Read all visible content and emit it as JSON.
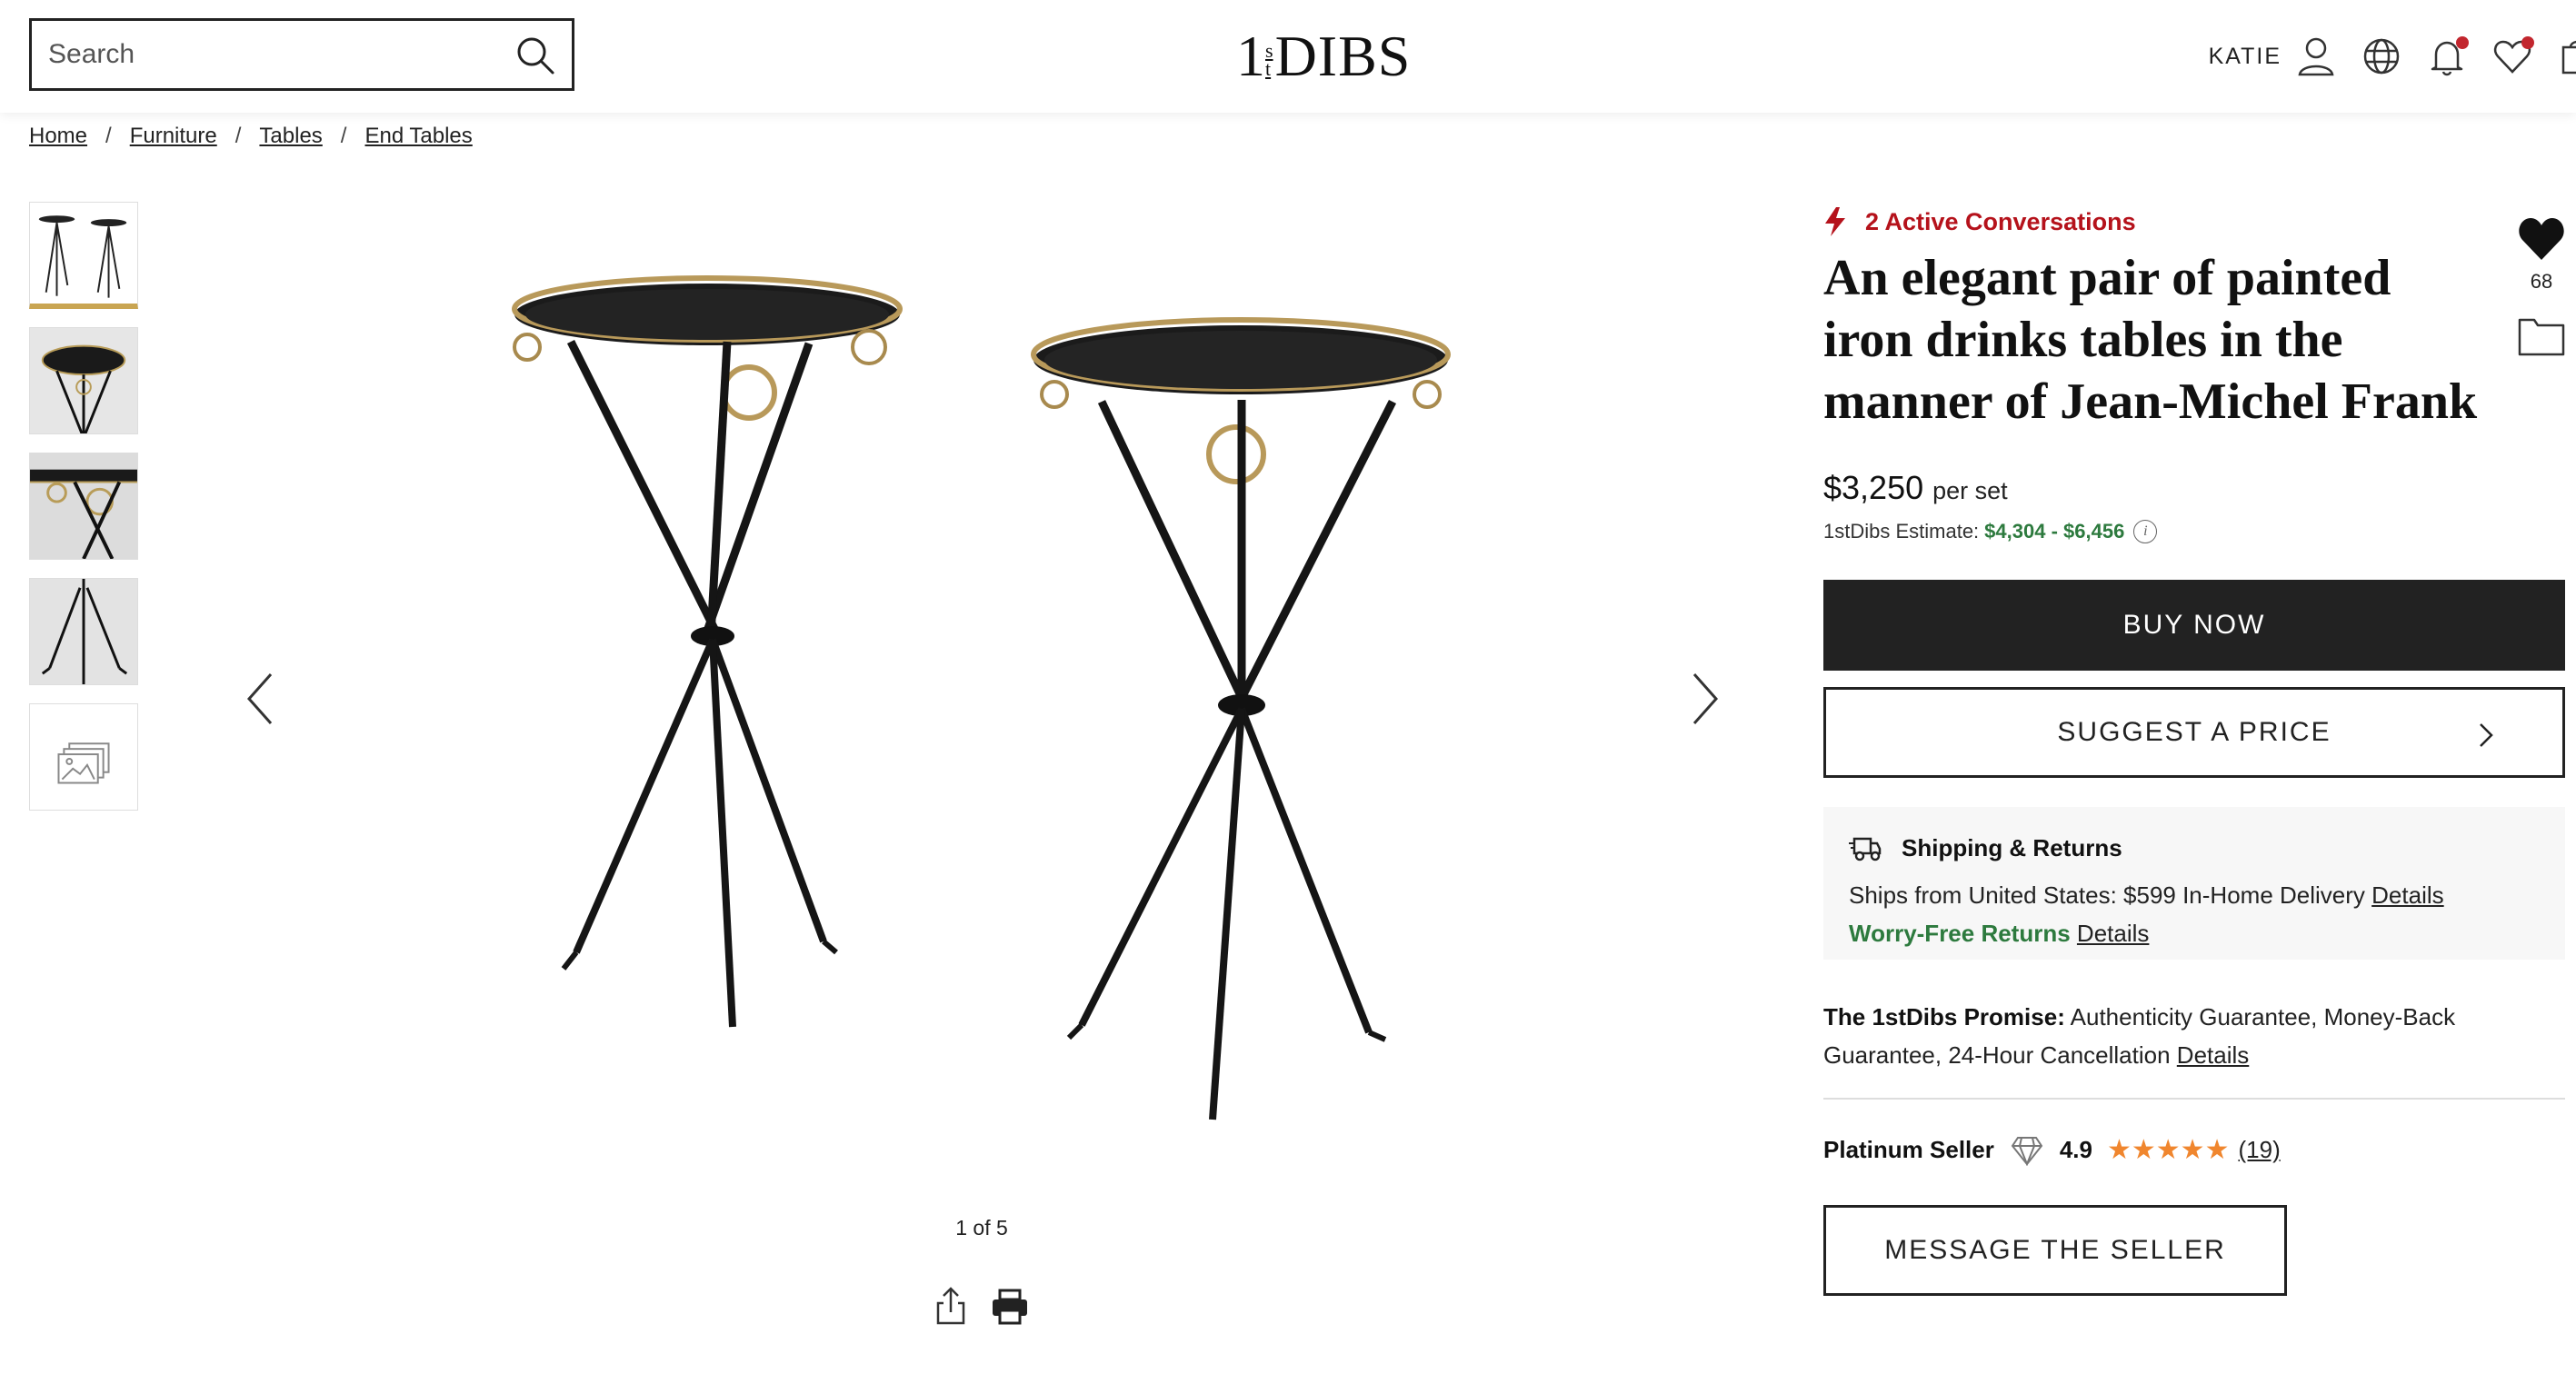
{
  "header": {
    "search_placeholder": "Search",
    "logo": {
      "one": "1",
      "st_top": "s",
      "st_bottom": "t",
      "dibs": "DIBS"
    },
    "user_name": "KATIE"
  },
  "breadcrumb": [
    {
      "label": "Home"
    },
    {
      "label": "Furniture"
    },
    {
      "label": "Tables"
    },
    {
      "label": "End Tables"
    }
  ],
  "breadcrumb_separator": "/",
  "gallery": {
    "counter": "1 of 5",
    "thumbnail_count": 5
  },
  "product": {
    "active_conversations": "2 Active Conversations",
    "title": "An elegant pair of painted iron drinks tables in the manner of Jean-Michel Frank",
    "favorites_count": "68",
    "price": "$3,250",
    "price_unit": "per set",
    "estimate_label": "1stDibs Estimate:",
    "estimate_range": "$4,304 - $6,456",
    "estimate_info": "i",
    "buy_label": "BUY NOW",
    "suggest_label": "SUGGEST A PRICE"
  },
  "shipping": {
    "heading": "Shipping & Returns",
    "ships_from": "Ships from United States: $599 In-Home Delivery",
    "details_label": "Details",
    "returns": "Worry-Free Returns",
    "returns_details_label": "Details"
  },
  "promise": {
    "label": "The 1stDibs Promise:",
    "text": "Authenticity Guarantee, Money-Back Guarantee, 24-Hour Cancellation",
    "details_label": "Details"
  },
  "seller": {
    "tier": "Platinum Seller",
    "rating": "4.9",
    "stars": "★★★★★",
    "reviews": "(19)",
    "message_label": "MESSAGE THE SELLER"
  },
  "colors": {
    "accent_red": "#b5121b",
    "estimate_green": "#2d7a3e",
    "star_orange": "#f0862e",
    "gold": "#c9a552",
    "notification_dot": "#c2262e"
  },
  "icons": [
    "search-icon",
    "user-icon",
    "globe-icon",
    "bell-icon",
    "heart-icon",
    "cart-icon",
    "bolt-icon",
    "folder-icon",
    "share-icon",
    "print-icon",
    "truck-icon",
    "diamond-icon",
    "chevron-left-icon",
    "chevron-right-icon"
  ]
}
